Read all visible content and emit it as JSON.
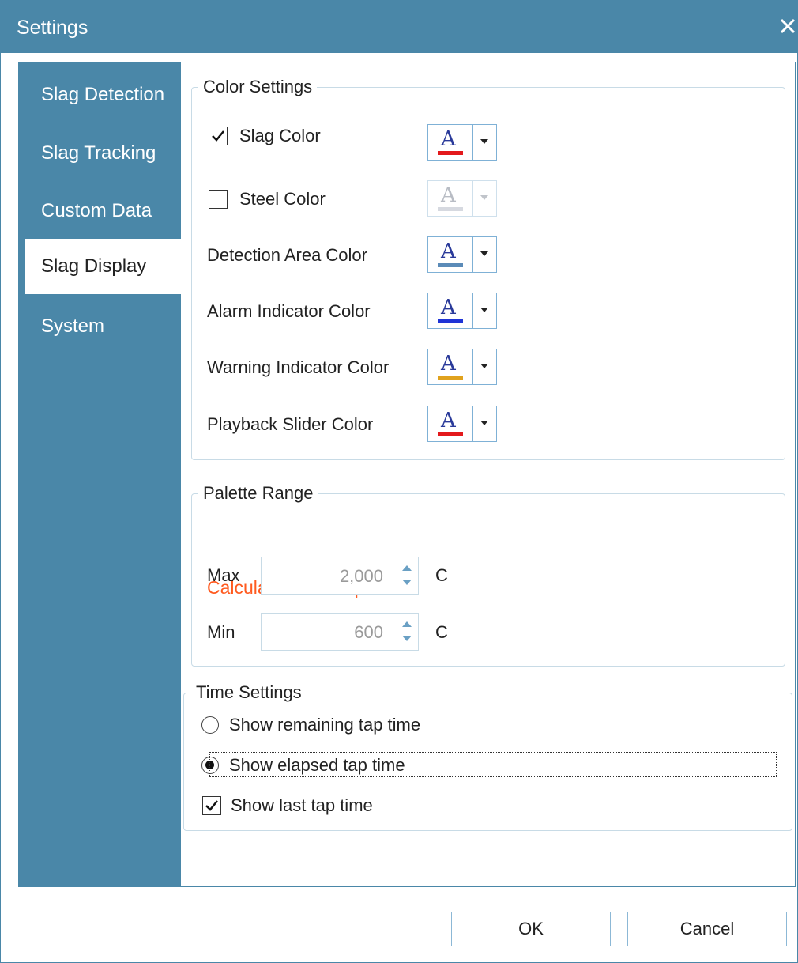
{
  "window": {
    "title": "Settings"
  },
  "sidebar": {
    "items": [
      {
        "label": "Slag Detection"
      },
      {
        "label": "Slag Tracking"
      },
      {
        "label": "Custom Data"
      },
      {
        "label": "Slag Display",
        "selected": true
      },
      {
        "label": "System"
      }
    ]
  },
  "color_settings": {
    "legend": "Color Settings",
    "rows": [
      {
        "label": "Slag Color",
        "has_checkbox": true,
        "checked": true,
        "enabled": true,
        "swatch": "#e3191c"
      },
      {
        "label": "Steel Color",
        "has_checkbox": true,
        "checked": false,
        "enabled": false,
        "swatch": "#d6d9e0"
      },
      {
        "label": "Detection Area Color",
        "has_checkbox": false,
        "enabled": true,
        "swatch": "#5b8bb8"
      },
      {
        "label": "Alarm Indicator Color",
        "has_checkbox": false,
        "enabled": true,
        "swatch": "#1f34d6"
      },
      {
        "label": "Warning Indicator Color",
        "has_checkbox": false,
        "enabled": true,
        "swatch": "#e0a21d"
      },
      {
        "label": "Playback Slider Color",
        "has_checkbox": false,
        "enabled": true,
        "swatch": "#e3191c"
      }
    ]
  },
  "palette_range": {
    "legend": "Palette Range",
    "status": "Calculated from tap",
    "max_label": "Max",
    "max_value": "2,000",
    "min_label": "Min",
    "min_value": "600",
    "unit": "C"
  },
  "time_settings": {
    "legend": "Time Settings",
    "remaining_label": "Show remaining tap time",
    "remaining_selected": false,
    "elapsed_label": "Show elapsed tap time",
    "elapsed_selected": true,
    "last_label": "Show last tap time",
    "last_checked": true
  },
  "buttons": {
    "ok": "OK",
    "cancel": "Cancel"
  },
  "colors": {
    "accent": "#4a87a8",
    "warning_text": "#ff5a1f",
    "border": "#c8dbe6"
  }
}
